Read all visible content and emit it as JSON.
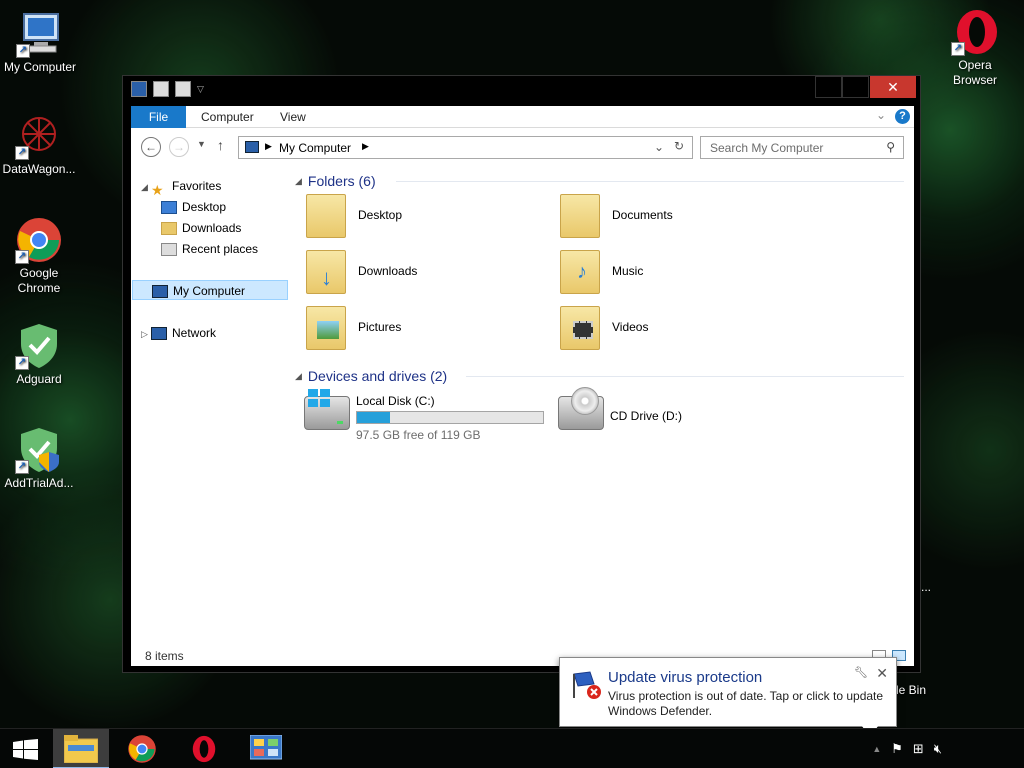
{
  "desktop": {
    "icons": [
      {
        "label": "My Computer"
      },
      {
        "label": "DataWagon..."
      },
      {
        "label": "Google Chrome"
      },
      {
        "label": "Adguard"
      },
      {
        "label": "AddTrialAd..."
      },
      {
        "label": "Opera Browser"
      }
    ],
    "partial_recycle_label": "le Bin",
    "partial_ellipsis": "..."
  },
  "explorer": {
    "ribbon": {
      "tabs": [
        "File",
        "Computer",
        "View"
      ]
    },
    "address": {
      "path_label": "My Computer"
    },
    "search": {
      "placeholder": "Search My Computer"
    },
    "navpane": {
      "favorites": "Favorites",
      "fav_items": [
        "Desktop",
        "Downloads",
        "Recent places"
      ],
      "my_computer": "My Computer",
      "network": "Network"
    },
    "groups": {
      "folders_title": "Folders (6)",
      "folders": [
        "Desktop",
        "Documents",
        "Downloads",
        "Music",
        "Pictures",
        "Videos"
      ],
      "devices_title": "Devices and drives (2)",
      "drives": [
        {
          "name": "Local Disk (C:)",
          "free_text": "97.5 GB free of 119 GB",
          "used_fraction": 0.18
        },
        {
          "name": "CD Drive (D:)"
        }
      ]
    },
    "status": {
      "items_count": "8 items"
    }
  },
  "notification": {
    "title": "Update virus protection",
    "message": "Virus protection is out of date. Tap or click to update Windows Defender."
  },
  "colors": {
    "accent": "#1979ca",
    "selection": "#cce8ff",
    "usage_bar": "#26a0da",
    "close_button": "#c8372e"
  }
}
